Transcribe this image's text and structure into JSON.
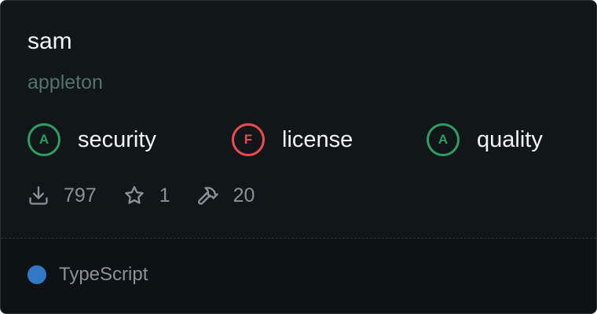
{
  "package": {
    "name": "sam",
    "owner": "appleton"
  },
  "grades": [
    {
      "letter": "A",
      "label": "security",
      "status": "pass"
    },
    {
      "letter": "F",
      "label": "license",
      "status": "fail"
    },
    {
      "letter": "A",
      "label": "quality",
      "status": "pass"
    }
  ],
  "stats": {
    "downloads": "797",
    "stars": "1",
    "builds": "20",
    "icons": [
      "download-icon",
      "star-icon",
      "hammer-icon"
    ]
  },
  "language": {
    "name": "TypeScript",
    "color": "#3178c6"
  },
  "colors": {
    "pass": "#2e9d64",
    "fail": "#f04a50",
    "background": "#111719"
  }
}
